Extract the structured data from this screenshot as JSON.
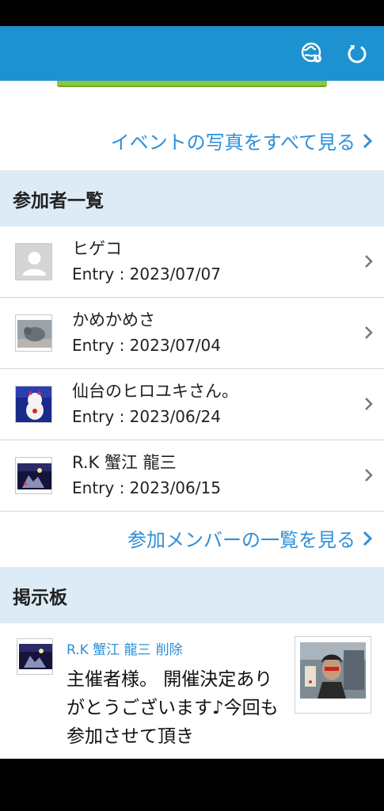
{
  "header": {
    "background_color": "#1e92d0",
    "icons": [
      "globe-icon",
      "refresh-icon"
    ]
  },
  "photos_link": {
    "label": "イベントの写真をすべて見る"
  },
  "participants_section": {
    "title": "参加者一覧",
    "items": [
      {
        "name": "ヒゲコ",
        "entry": "Entry : 2023/07/07",
        "avatar": "default-user-icon"
      },
      {
        "name": "かめかめさ",
        "entry": "Entry : 2023/07/04",
        "avatar": "cat-photo"
      },
      {
        "name": "仙台のヒロユキさん。",
        "entry": "Entry : 2023/06/24",
        "avatar": "lucky-cat-photo"
      },
      {
        "name": "R.K 蟹江 龍三",
        "entry": "Entry : 2023/06/15",
        "avatar": "night-scene-photo"
      }
    ],
    "more_link": "参加メンバーの一覧を見る"
  },
  "board_section": {
    "title": "掲示板",
    "post": {
      "author": "R.K 蟹江 龍三",
      "delete_label": "削除",
      "text": "主催者様。 開催決定ありがとうございます♪今回も参加させて頂き"
    }
  },
  "colors": {
    "accent": "#1e92d0",
    "link": "#2f8fd8",
    "section_bg": "#dcebf5",
    "button_green": "#8cc63f"
  }
}
